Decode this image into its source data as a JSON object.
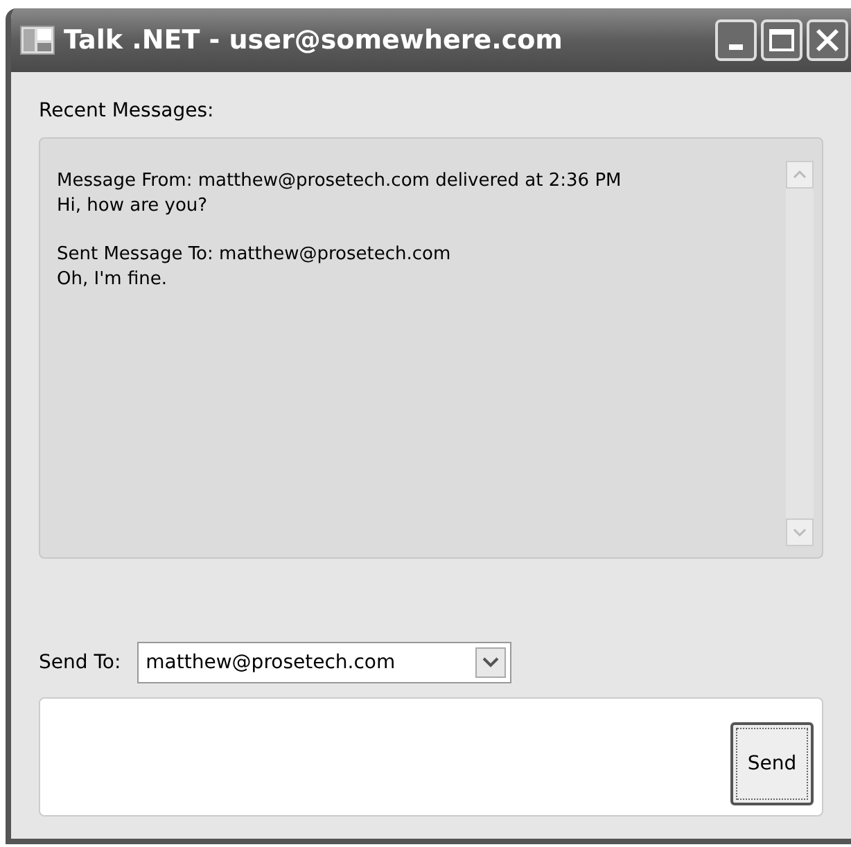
{
  "window": {
    "title": "Talk .NET - user@somewhere.com"
  },
  "recent_label": "Recent Messages:",
  "messages": [
    {
      "header": "Message From: matthew@prosetech.com delivered at 2:36 PM",
      "body": "Hi, how are you?"
    },
    {
      "header": "Sent Message To: matthew@prosetech.com",
      "body": "Oh, I'm fine."
    }
  ],
  "send_to": {
    "label": "Send To:",
    "value": "matthew@prosetech.com"
  },
  "send_button": "Send"
}
